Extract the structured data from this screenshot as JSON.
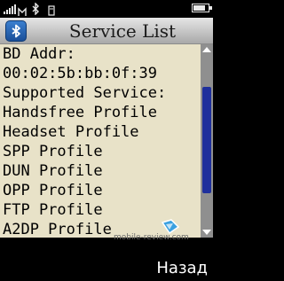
{
  "status": {
    "signal_level": 5,
    "battery_level": 0.8,
    "icons": [
      "signal-icon",
      "connection-icon",
      "bluetooth-icon",
      "profile-icon",
      "battery-icon"
    ]
  },
  "title_bar": {
    "icon": "bluetooth-icon",
    "title": "Service List"
  },
  "content": {
    "lines": [
      "BD Addr:",
      "00:02:5b:bb:0f:39",
      "Supported Service:",
      "Handsfree Profile",
      "Headset Profile",
      "SPP Profile",
      "DUN Profile",
      "OPP Profile",
      "FTP Profile",
      "A2DP Profile"
    ]
  },
  "watermark": "mobile-review.com",
  "softkeys": {
    "right": "Назад"
  },
  "colors": {
    "content_bg": "#e8e2c8",
    "scroll_thumb": "#1e2f9c",
    "bluetooth_badge": "#2a66b5"
  }
}
